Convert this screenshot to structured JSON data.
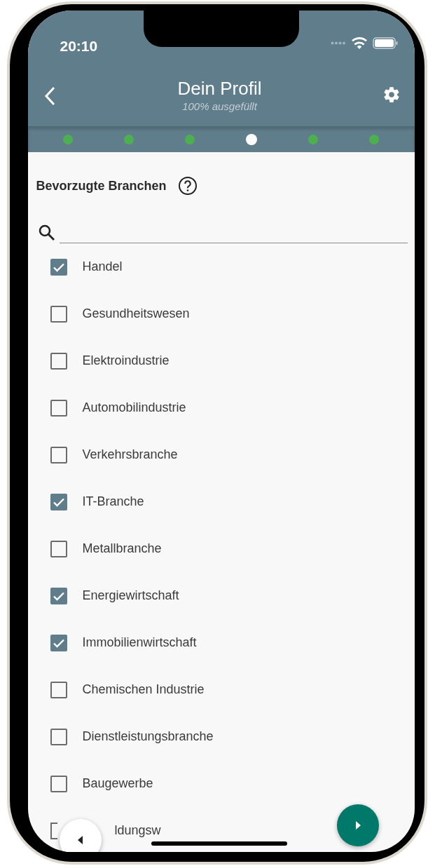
{
  "status_bar": {
    "time": "20:10"
  },
  "header": {
    "title": "Dein Profil",
    "subtitle": "100% ausgefüllt"
  },
  "steps": [
    {
      "selected": false
    },
    {
      "selected": false
    },
    {
      "selected": false
    },
    {
      "selected": true
    },
    {
      "selected": false
    },
    {
      "selected": false
    }
  ],
  "section": {
    "title": "Bevorzugte Branchen"
  },
  "items": [
    {
      "label": "Handel",
      "checked": true
    },
    {
      "label": "Gesundheitswesen",
      "checked": false
    },
    {
      "label": "Elektroindustrie",
      "checked": false
    },
    {
      "label": "Automobilindustrie",
      "checked": false
    },
    {
      "label": "Verkehrsbranche",
      "checked": false
    },
    {
      "label": "IT-Branche",
      "checked": true
    },
    {
      "label": "Metallbranche",
      "checked": false
    },
    {
      "label": "Energiewirtschaft",
      "checked": true
    },
    {
      "label": "Immobilienwirtschaft",
      "checked": true
    },
    {
      "label": "Chemischen Industrie",
      "checked": false
    },
    {
      "label": "Dienstleistungsbranche",
      "checked": false
    },
    {
      "label": "Baugewerbe",
      "checked": false
    },
    {
      "label": "ldungsw",
      "checked": false,
      "partial": true
    }
  ]
}
